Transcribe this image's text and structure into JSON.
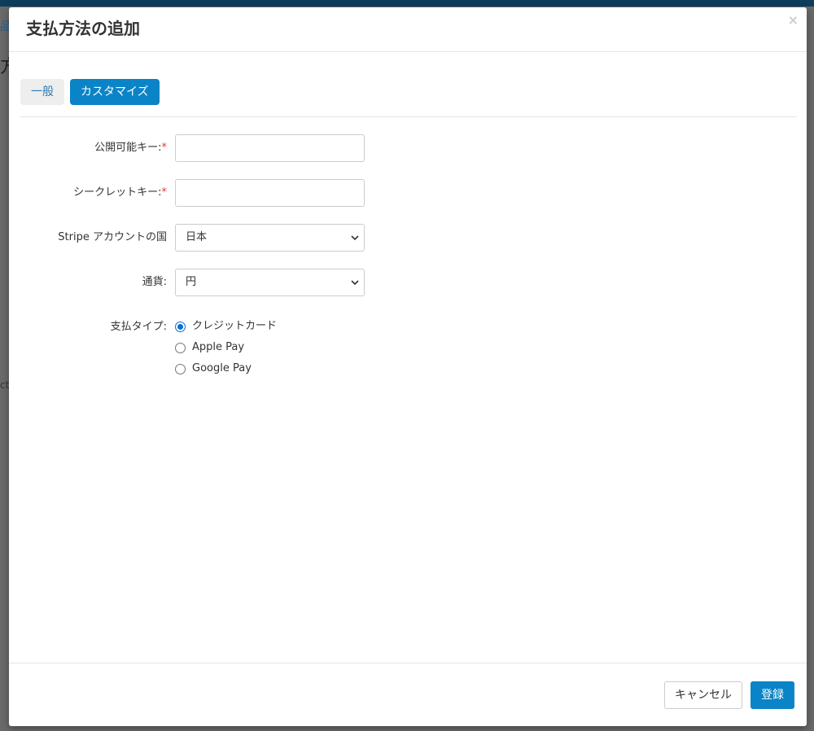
{
  "background": {
    "breadcrumb_fragment": "品",
    "heading_fragment": "方",
    "text_fragment": "ct"
  },
  "modal": {
    "title": "支払方法の追加",
    "close_icon": "×"
  },
  "tabs": [
    {
      "label": "一般",
      "active": false
    },
    {
      "label": "カスタマイズ",
      "active": true
    }
  ],
  "form": {
    "publishable_key": {
      "label": "公開可能キー:",
      "required_mark": "*",
      "value": ""
    },
    "secret_key": {
      "label": "シークレットキー:",
      "required_mark": "*",
      "value": ""
    },
    "account_country": {
      "label": "Stripe アカウントの国",
      "selected": "日本"
    },
    "currency": {
      "label": "通貨:",
      "selected": "円"
    },
    "payment_type": {
      "label": "支払タイプ:",
      "options": [
        {
          "label": "クレジットカード",
          "checked": true
        },
        {
          "label": "Apple Pay",
          "checked": false
        },
        {
          "label": "Google Pay",
          "checked": false
        }
      ]
    }
  },
  "footer": {
    "cancel_label": "キャンセル",
    "submit_label": "登録"
  },
  "colors": {
    "primary": "#0a84c7",
    "header_bar": "#0d3d5c",
    "required": "#e03a3a",
    "overlay": "#6a6a6a"
  }
}
